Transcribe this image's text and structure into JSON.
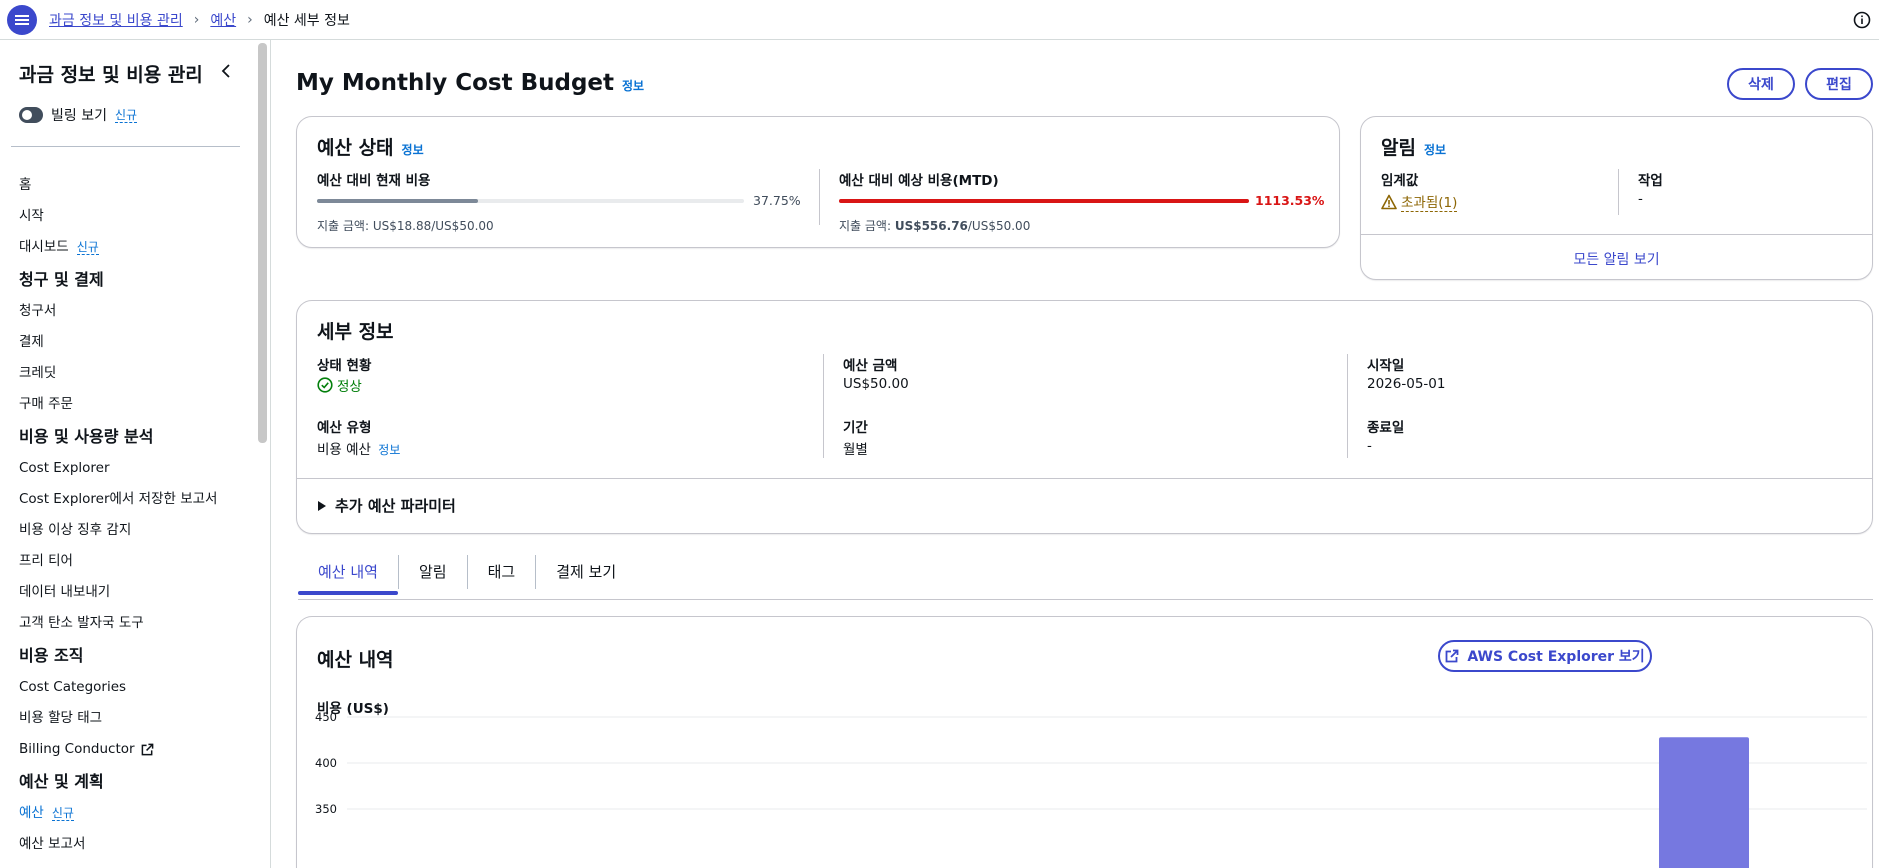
{
  "breadcrumb": {
    "items": [
      "과금 정보 및 비용 관리",
      "예산"
    ],
    "current": "예산 세부 정보"
  },
  "sidebar": {
    "title": "과금 정보 및 비용 관리",
    "toggle_label": "빌링 보기",
    "new_badge": "신규",
    "items": [
      {
        "label": "홈",
        "type": "item"
      },
      {
        "label": "시작",
        "type": "item"
      },
      {
        "label": "대시보드",
        "type": "item",
        "badge": "신규"
      },
      {
        "label": "청구 및 결제",
        "type": "heading"
      },
      {
        "label": "청구서",
        "type": "item"
      },
      {
        "label": "결제",
        "type": "item"
      },
      {
        "label": "크레딧",
        "type": "item"
      },
      {
        "label": "구매 주문",
        "type": "item"
      },
      {
        "label": "비용 및 사용량 분석",
        "type": "heading"
      },
      {
        "label": "Cost Explorer",
        "type": "item"
      },
      {
        "label": "Cost Explorer에서 저장한 보고서",
        "type": "item"
      },
      {
        "label": "비용 이상 징후 감지",
        "type": "item"
      },
      {
        "label": "프리 티어",
        "type": "item"
      },
      {
        "label": "데이터 내보내기",
        "type": "item"
      },
      {
        "label": "고객 탄소 발자국 도구",
        "type": "item"
      },
      {
        "label": "비용 조직",
        "type": "heading"
      },
      {
        "label": "Cost Categories",
        "type": "item"
      },
      {
        "label": "비용 할당 태그",
        "type": "item"
      },
      {
        "label": "Billing Conductor",
        "type": "item",
        "external": true
      },
      {
        "label": "예산 및 계획",
        "type": "heading"
      },
      {
        "label": "예산",
        "type": "item",
        "active": true,
        "badge": "신규"
      },
      {
        "label": "예산 보고서",
        "type": "item"
      }
    ]
  },
  "page": {
    "title": "My Monthly Cost Budget",
    "info": "정보",
    "delete_label": "삭제",
    "edit_label": "편집"
  },
  "budget_status": {
    "title": "예산 상태",
    "info": "정보",
    "current": {
      "label": "예산 대비 현재 비용",
      "percent": "37.75%",
      "fraction": 0.3775,
      "spent_prefix": "지출 금액: ",
      "spent": "US$18.88",
      "total": "/US$50.00"
    },
    "forecast": {
      "label": "예산 대비 예상 비용(MTD)",
      "percent": "1113.53%",
      "fraction": 1.0,
      "spent_prefix": "지출 금액: ",
      "spent": "US$556.76",
      "total": "/US$50.00"
    }
  },
  "alerts": {
    "title": "알림",
    "info": "정보",
    "threshold_label": "임계값",
    "threshold_value": "초과됨(1)",
    "action_label": "작업",
    "action_value": "-",
    "view_all": "모든 알림 보기"
  },
  "details": {
    "title": "세부 정보",
    "status_label": "상태 현황",
    "status_value": "정상",
    "amount_label": "예산 금액",
    "amount_value": "US$50.00",
    "start_label": "시작일",
    "start_value": "2026-05-01",
    "type_label": "예산 유형",
    "type_value": "비용 예산",
    "type_info": "정보",
    "period_label": "기간",
    "period_value": "월별",
    "end_label": "종료일",
    "end_value": "-",
    "expand_label": "추가 예산 파라미터"
  },
  "tabs": [
    {
      "label": "예산 내역",
      "active": true
    },
    {
      "label": "알림"
    },
    {
      "label": "태그"
    },
    {
      "label": "결제 보기"
    }
  ],
  "history": {
    "title": "예산 내역",
    "explorer_button": "AWS Cost Explorer 보기"
  },
  "chart_data": {
    "type": "bar",
    "ylabel": "비용 (US$)",
    "yticks": [
      450,
      400,
      350
    ],
    "ylim": [
      330,
      460
    ],
    "values": [
      428
    ],
    "grid": true
  },
  "colors": {
    "primary": "#3b48cc",
    "link": "#0972d3",
    "progress": "#7d8998",
    "danger": "#d91515",
    "success": "#037f0c",
    "warning": "#8d6605",
    "bar": "#7678e0"
  }
}
